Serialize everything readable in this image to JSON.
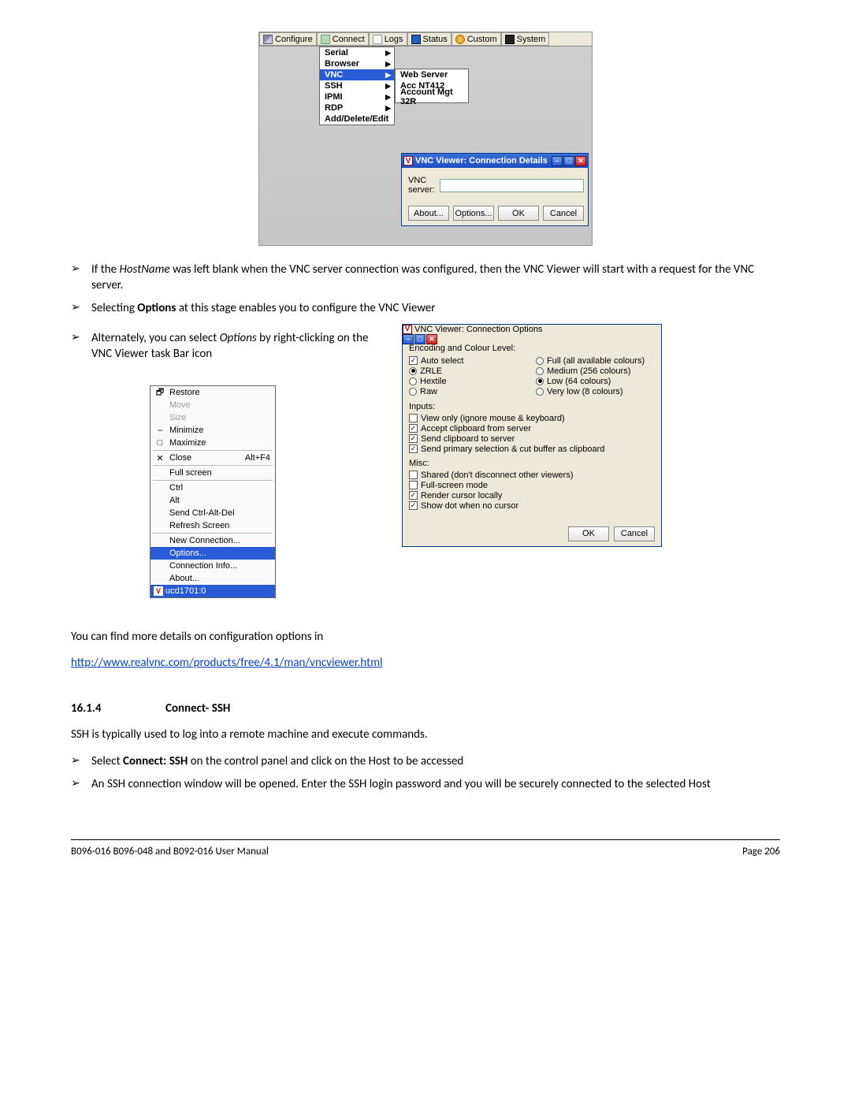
{
  "fig1": {
    "toolbar": [
      "Configure",
      "Connect",
      "Logs",
      "Status",
      "Custom",
      "System"
    ],
    "menu1": [
      {
        "label": "Serial",
        "arrow": true
      },
      {
        "label": "Browser",
        "arrow": true
      },
      {
        "label": "VNC",
        "arrow": true,
        "selected": true
      },
      {
        "label": "SSH",
        "arrow": true
      },
      {
        "label": "IPMI",
        "arrow": true
      },
      {
        "label": "RDP",
        "arrow": true
      },
      {
        "label": "Add/Delete/Edit",
        "arrow": false
      }
    ],
    "menu2": [
      "Web Server",
      "Acc NT412",
      "Account Mgt 32R"
    ],
    "dialog_title": "VNC Viewer: Connection Details",
    "server_label": "VNC server:",
    "buttons": [
      "About...",
      "Options...",
      "OK",
      "Cancel"
    ]
  },
  "para1_a": "If the ",
  "para1_host": "HostName",
  "para1_b": " was left blank when the VNC server connection was configured, then the VNC Viewer will start with a request for the VNC server.",
  "para2_a": "Selecting ",
  "para2_opt": "Options",
  "para2_b": " at this stage enables you to  configure the VNC Viewer",
  "para3_a": "Alternately, you can select ",
  "para3_opt": "Options",
  "para3_b": " by right-clicking on the VNC Viewer task Bar icon",
  "fig2": {
    "items": [
      {
        "glyph": "🗗",
        "label": "Restore"
      },
      {
        "label": "Move",
        "dim": true
      },
      {
        "label": "Size",
        "dim": true
      },
      {
        "glyph": "–",
        "label": "Minimize"
      },
      {
        "glyph": "□",
        "label": "Maximize"
      },
      {
        "sep": true
      },
      {
        "glyph": "✕",
        "label": "Close",
        "shortcut": "Alt+F4"
      },
      {
        "sep": true
      },
      {
        "label": "Full screen"
      },
      {
        "sep": true
      },
      {
        "label": "Ctrl"
      },
      {
        "label": "Alt"
      },
      {
        "label": "Send Ctrl-Alt-Del"
      },
      {
        "label": "Refresh Screen"
      },
      {
        "sep": true
      },
      {
        "label": "New Connection..."
      },
      {
        "label": "Options...",
        "selected": true
      },
      {
        "label": "Connection Info..."
      },
      {
        "label": "About..."
      }
    ],
    "taskbar": "ucd1701:0"
  },
  "fig3": {
    "title": "VNC Viewer: Connection Options",
    "enc_label": "Encoding and Colour Level:",
    "enc_left": [
      {
        "type": "chk",
        "label": "Auto select",
        "checked": true
      },
      {
        "type": "rdo",
        "label": "ZRLE",
        "on": true
      },
      {
        "type": "rdo",
        "label": "Hextile"
      },
      {
        "type": "rdo",
        "label": "Raw"
      }
    ],
    "enc_right": [
      {
        "type": "rdo",
        "label": "Full (all available colours)"
      },
      {
        "type": "rdo",
        "label": "Medium (256 colours)"
      },
      {
        "type": "rdo",
        "label": "Low (64 colours)",
        "on": true
      },
      {
        "type": "rdo",
        "label": "Very low (8 colours)"
      }
    ],
    "inputs_label": "Inputs:",
    "inputs": [
      {
        "label": "View only (ignore mouse & keyboard)",
        "checked": false
      },
      {
        "label": "Accept clipboard from server",
        "checked": true
      },
      {
        "label": "Send clipboard to server",
        "checked": true
      },
      {
        "label": "Send primary selection & cut buffer as clipboard",
        "checked": true
      }
    ],
    "misc_label": "Misc:",
    "misc": [
      {
        "label": "Shared (don't disconnect other viewers)",
        "checked": false
      },
      {
        "label": "Full-screen mode",
        "checked": false
      },
      {
        "label": "Render cursor locally",
        "checked": true
      },
      {
        "label": "Show dot when no cursor",
        "checked": true
      }
    ],
    "ok": "OK",
    "cancel": "Cancel"
  },
  "more_details": "You can find more details on configuration options in",
  "link": "http://www.realvnc.com/products/free/4.1/man/vncviewer.html",
  "sect_num": "16.1.4",
  "sect_title": "Connect- SSH",
  "ssh_intro": "SSH is typically used to log into a remote machine and execute commands.",
  "ssh_b1_a": "Select ",
  "ssh_b1_bold": "Connect: SSH",
  "ssh_b1_b": " on the control panel and click on the Host to be accessed",
  "ssh_b2": "An SSH connection window will be opened. Enter the SSH login password and you will be securely connected to the selected Host",
  "footer_left": "B096-016 B096-048 and B092-016 User Manual",
  "footer_right": "Page 206"
}
